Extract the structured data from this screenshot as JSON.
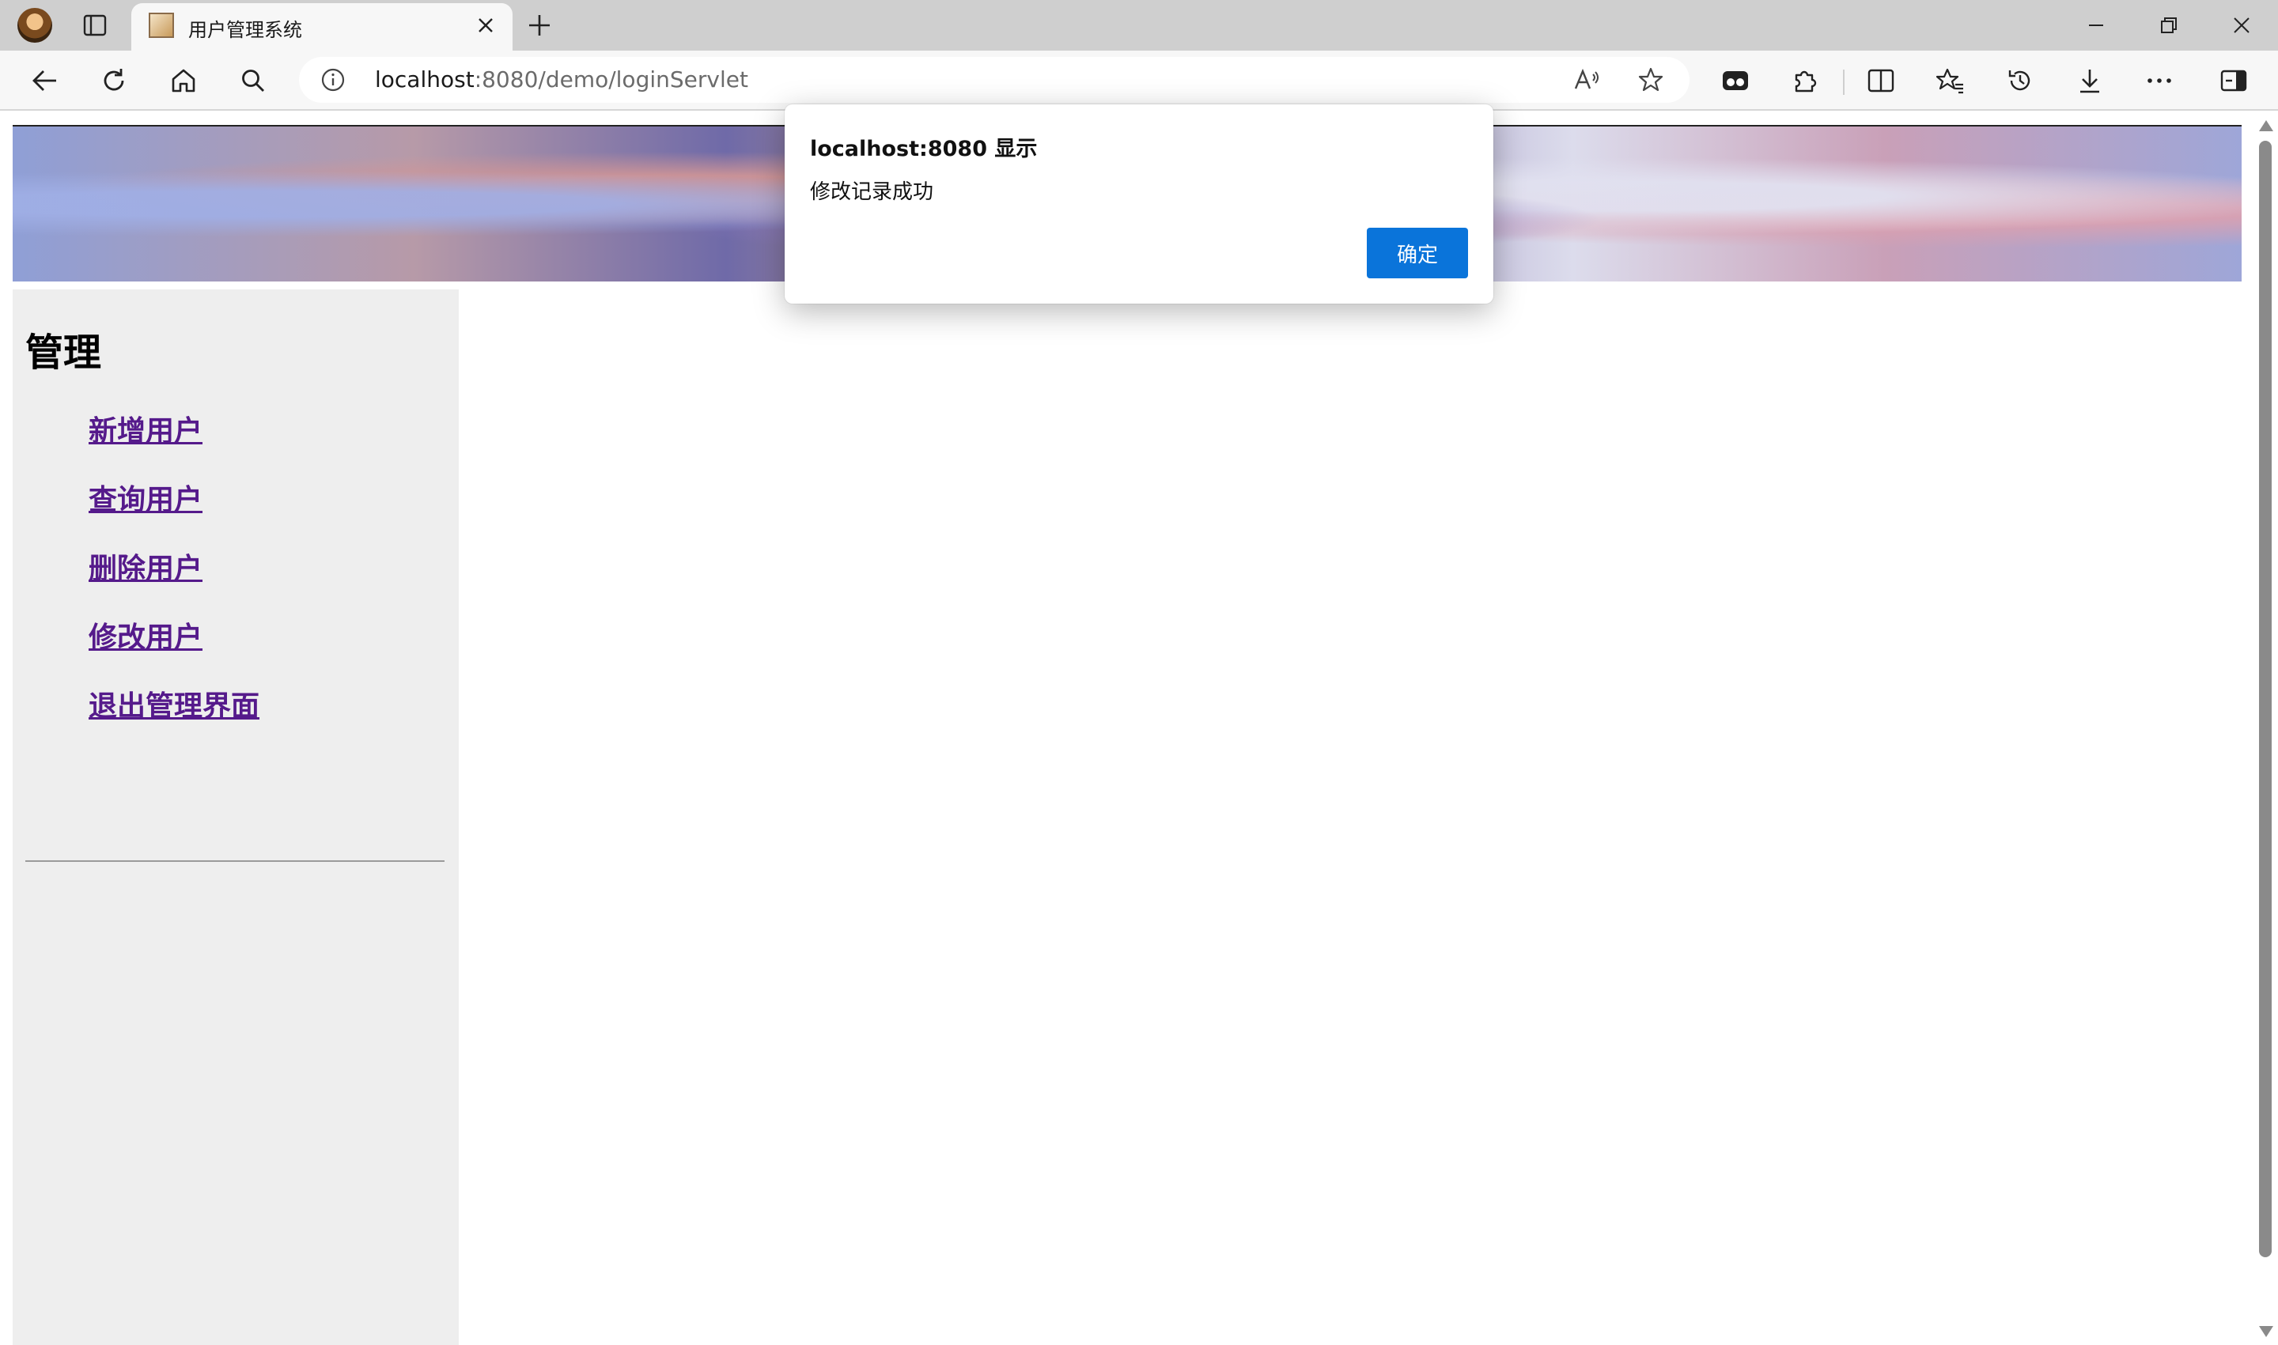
{
  "browser": {
    "tab": {
      "title": "用户管理系统"
    },
    "address": {
      "host": "localhost",
      "path": ":8080/demo/loginServlet"
    },
    "icons": [
      "back-icon",
      "refresh-icon",
      "home-icon",
      "search-icon",
      "info-icon",
      "read-aloud-icon",
      "favorite-star-icon",
      "collections-icon",
      "extensions-icon",
      "split-screen-icon",
      "favorites-icon",
      "history-icon",
      "download-icon",
      "more-icon",
      "sidebar-icon"
    ]
  },
  "page": {
    "sidebar": {
      "title": "管理",
      "menu": [
        {
          "label": "新增用户"
        },
        {
          "label": "查询用户"
        },
        {
          "label": "删除用户"
        },
        {
          "label": "修改用户"
        },
        {
          "label": "退出管理界面"
        }
      ]
    }
  },
  "dialog": {
    "title": "localhost:8080 显示",
    "message": "修改记录成功",
    "ok_label": "确定"
  },
  "colors": {
    "accent": "#0a74da",
    "link_visited": "#551a8b",
    "sidebar_bg": "#eeeeee"
  }
}
